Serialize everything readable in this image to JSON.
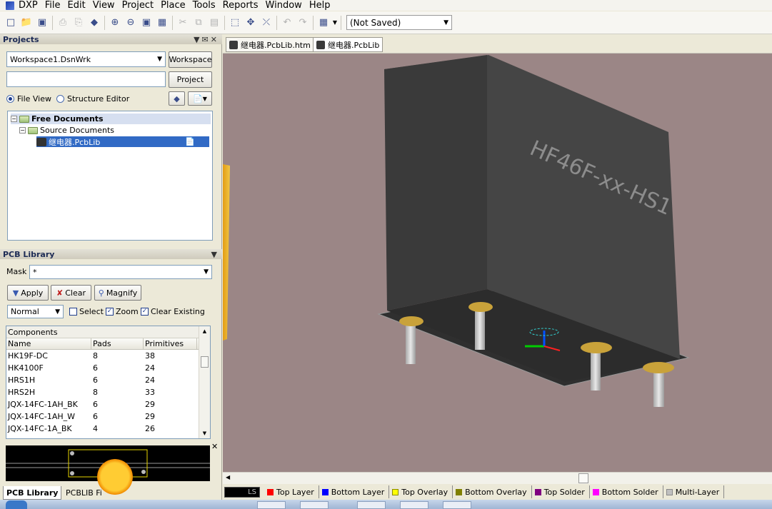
{
  "app": {
    "name": "DXP"
  },
  "menu": [
    "Edit",
    "View",
    "Project",
    "Place",
    "Tools",
    "Reports",
    "Window",
    "Help"
  ],
  "toolbar": {
    "doc_state": "(Not Saved)"
  },
  "projects_panel": {
    "title": "Projects",
    "workspace_value": "Workspace1.DsnWrk",
    "workspace_button": "Workspace",
    "project_button": "Project",
    "file_view_label": "File View",
    "structure_editor_label": "Structure Editor",
    "tree": {
      "root": "Free Documents",
      "child": "Source Documents",
      "file": "继电器.PcbLib"
    }
  },
  "pcb_library": {
    "title": "PCB Library",
    "mask_label": "Mask",
    "mask_value": "*",
    "apply_label": "Apply",
    "clear_label": "Clear",
    "magnify_label": "Magnify",
    "mode_value": "Normal",
    "select_label": "Select",
    "zoom_label": "Zoom",
    "clear_existing_label": "Clear Existing",
    "components_caption": "Components",
    "columns": [
      "Name",
      "Pads",
      "Primitives"
    ],
    "rows": [
      [
        "HK19F-DC",
        "8",
        "38"
      ],
      [
        "HK4100F",
        "6",
        "24"
      ],
      [
        "HRS1H",
        "6",
        "24"
      ],
      [
        "HRS2H",
        "8",
        "33"
      ],
      [
        "JQX-14FC-1AH_BK",
        "6",
        "29"
      ],
      [
        "JQX-14FC-1AH_W",
        "6",
        "29"
      ],
      [
        "JQX-14FC-1A_BK",
        "4",
        "26"
      ]
    ],
    "tab_active": "PCB Library",
    "tab_other": "PCBLIB Fi"
  },
  "doc_tabs": [
    "继电器.PcbLib.htm",
    "继电器.PcbLib"
  ],
  "viewport": {
    "component_text": "HF46F-xx-HS1"
  },
  "layers": {
    "current": "LS",
    "items": [
      {
        "name": "Top Layer",
        "color": "#ff0000"
      },
      {
        "name": "Bottom Layer",
        "color": "#0000ff"
      },
      {
        "name": "Top Overlay",
        "color": "#ffff00"
      },
      {
        "name": "Bottom Overlay",
        "color": "#808000"
      },
      {
        "name": "Top Solder",
        "color": "#800080"
      },
      {
        "name": "Bottom Solder",
        "color": "#ff00ff"
      },
      {
        "name": "Multi-Layer",
        "color": "#c0c0c0"
      }
    ]
  }
}
